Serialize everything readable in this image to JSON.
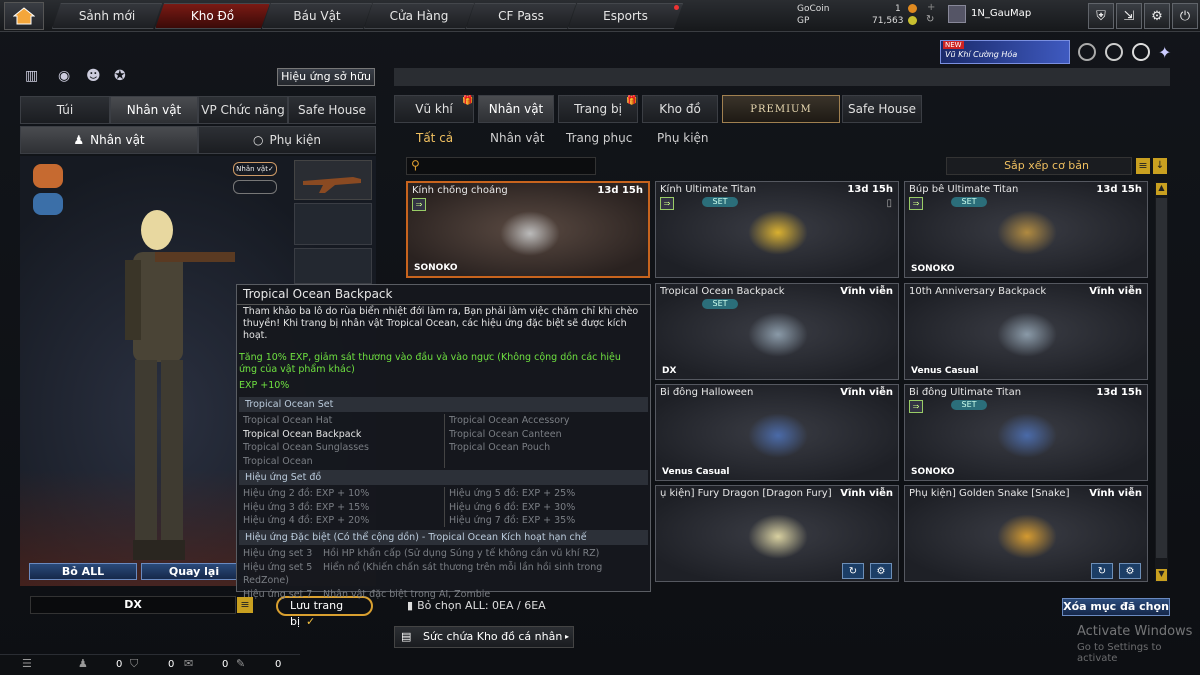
{
  "nav": {
    "tabs": [
      "Sảnh mới",
      "Kho Đồ",
      "Báu Vật",
      "Cửa Hàng",
      "CF Pass",
      "Esports"
    ],
    "active": 1
  },
  "currency": {
    "gocoin_label": "GoCoin",
    "gp_label": "GP",
    "gocoin": "1",
    "gp": "71,563"
  },
  "user": {
    "name": "1N_GauMap"
  },
  "banner": {
    "badge": "NEW",
    "text": "Vũ Khí Cường Hóa"
  },
  "effect_button": "Hiệu ứng sở hữu",
  "left_tabs": [
    "Túi",
    "Nhân vật",
    "VP Chức năng",
    "Safe House"
  ],
  "left_subtabs": [
    "Nhân vật",
    "Phụ kiện"
  ],
  "char_tag": "Nhân vật✓",
  "bottom_left": {
    "remove_all": "Bỏ ALL",
    "back": "Quay lại",
    "char_name": "DX",
    "save": "Lưu trang bị"
  },
  "right_tabs": [
    "Vũ khí",
    "Nhân vật",
    "Trang bị",
    "Kho đồ",
    "PREMIUM",
    "Safe House"
  ],
  "right_subtabs": [
    "Tất cả",
    "Nhân vật",
    "Trang phục",
    "Phụ kiện"
  ],
  "sort_label": "Sắp xếp cơ bản",
  "items": [
    {
      "name": "Kính chống choáng",
      "time": "13d 15h",
      "footer": "SONOKO",
      "set": "",
      "icon": "sunglasses-icon"
    },
    {
      "name": "Kính Ultimate Titan",
      "time": "13d 15h",
      "footer": "",
      "set": "SET",
      "icon": "goggles-icon"
    },
    {
      "name": "Búp bê Ultimate Titan",
      "time": "13d 15h",
      "footer": "SONOKO",
      "set": "SET",
      "icon": "doll-icon"
    },
    {
      "name": "Tropical Ocean Backpack",
      "time": "Vĩnh viễn",
      "footer": "DX",
      "set": "SET",
      "icon": "backpack-icon"
    },
    {
      "name": "10th Anniversary Backpack",
      "time": "Vĩnh viễn",
      "footer": "Venus Casual",
      "set": "",
      "icon": "backpack-icon"
    },
    {
      "name": "Bi đông Halloween",
      "time": "Vĩnh viễn",
      "footer": "Venus Casual",
      "set": "",
      "icon": "canteen-icon"
    },
    {
      "name": "Bi đông Ultimate Titan",
      "time": "13d 15h",
      "footer": "SONOKO",
      "set": "SET",
      "icon": "canteen-icon"
    },
    {
      "name": "ụ kiện] Fury Dragon [Dragon Fury]",
      "time": "Vĩnh viễn",
      "footer": "",
      "set": "",
      "icon": "dragon-icon"
    },
    {
      "name": "Phụ kiện] Golden Snake [Snake]",
      "time": "Vĩnh viễn",
      "footer": "",
      "set": "",
      "icon": "snake-icon"
    }
  ],
  "selected_count": "Bỏ chọn ALL: 0EA / 6EA",
  "clear_selected": "Xóa mục đã chọn",
  "storage": "Sức chứa Kho đồ cá nhân",
  "tooltip": {
    "title": "Tropical Ocean Backpack",
    "desc": "Tham khảo ba lô do rùa biển nhiệt đới làm ra, Bạn phải làm việc chăm chỉ khi chèo thuyền! Khi trang bị nhân vật Tropical Ocean, các hiệu ứng đặc biệt sẽ được kích hoạt.",
    "bonus": "Tăng 10% EXP, giảm sát thương vào đầu và vào ngực (Không cộng dồn các hiệu ứng của vật phẩm khác)",
    "exp": "EXP +10%",
    "set_header": "Tropical Ocean Set",
    "set_left": [
      "Tropical Ocean Hat",
      "Tropical Ocean Backpack",
      "Tropical Ocean Sunglasses",
      "Tropical Ocean"
    ],
    "set_right": [
      "Tropical Ocean Accessory",
      "Tropical Ocean Canteen",
      "Tropical Ocean Pouch"
    ],
    "effect_header": "Hiệu ứng Set đồ",
    "eff_left": [
      "Hiệu ứng 2 đồ: EXP + 10%",
      "Hiệu ứng 3 đồ: EXP + 15%",
      "Hiệu ứng 4 đồ: EXP + 20%"
    ],
    "eff_right": [
      "Hiệu ứng 5 đồ: EXP + 25%",
      "Hiệu ứng 6 đồ: EXP + 30%",
      "Hiệu ứng 7 đồ: EXP + 35%"
    ],
    "special_header": "Hiệu ứng Đặc biệt (Có thể cộng dồn) - Tropical Ocean Kích hoạt hạn chế",
    "special": [
      [
        "Hiệu ứng set 3",
        "Hồi HP khẩn cấp (Sử dụng Súng y tế không cần vũ khí RZ)"
      ],
      [
        "Hiệu ứng set 5",
        "Hiển nổ (Khiến chấn sát thương trên mỗi lần hồi sinh trong RedZone)"
      ],
      [
        "Hiệu ứng set 7",
        "Nhân vật đặc biệt trong AI, Zombie"
      ]
    ]
  },
  "statusbar": {
    "a": "0",
    "b": "0",
    "c": "0",
    "d": "0"
  },
  "watermark": {
    "line1": "Activate Windows",
    "line2": "Go to Settings to activate"
  }
}
